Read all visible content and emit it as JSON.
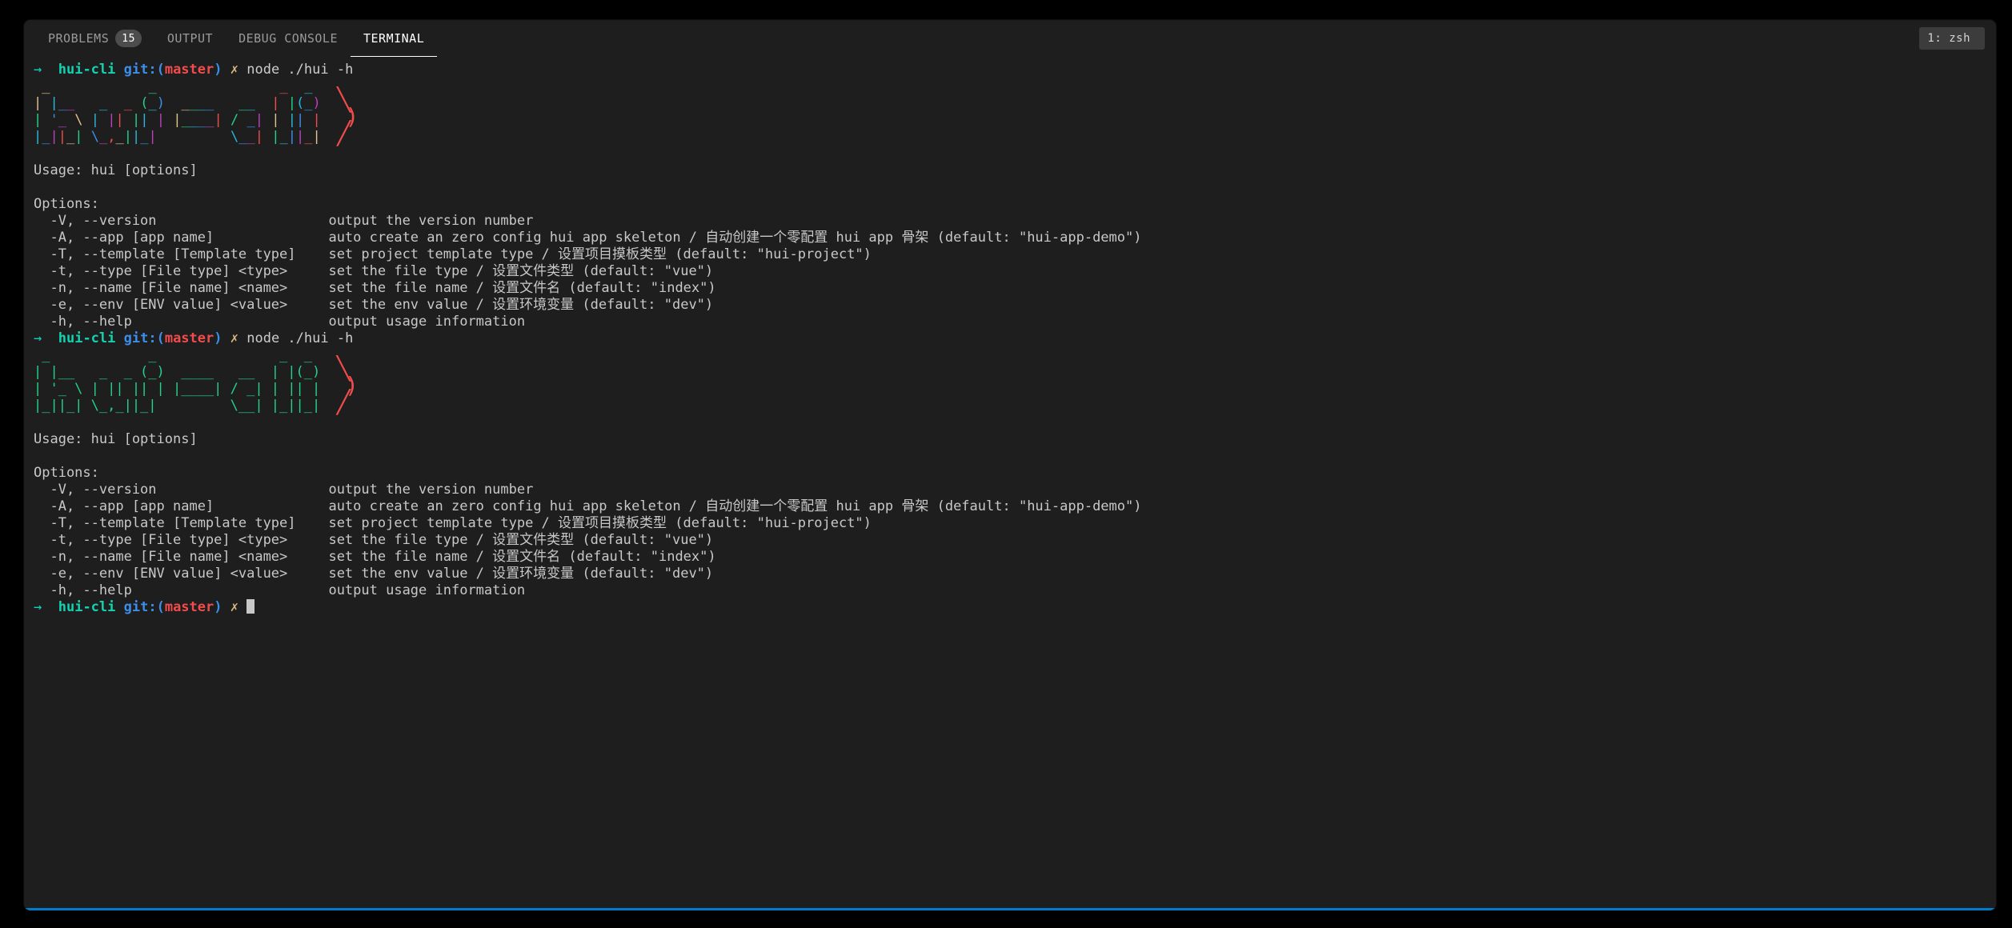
{
  "tabs": {
    "problems": "PROBLEMS",
    "problems_badge": "15",
    "output": "OUTPUT",
    "debug_console": "DEBUG CONSOLE",
    "terminal": "TERMINAL"
  },
  "task_dropdown": "1: zsh",
  "prompt": {
    "arrow": "→",
    "dir": "hui-cli",
    "git_label": "git:(",
    "branch": "master",
    "git_close": ")",
    "dirty": "✗",
    "command": "node ./hui -h"
  },
  "banner_text": "hui-cli",
  "help": {
    "usage_label": "Usage:",
    "usage": "hui [options]",
    "options_label": "Options:",
    "rows": [
      {
        "flag": "-V, --version",
        "desc": "output the version number"
      },
      {
        "flag": "-A, --app [app name]",
        "desc": "auto create an zero config hui app skeleton / 自动创建一个零配置 hui app 骨架 (default: \"hui-app-demo\")"
      },
      {
        "flag": "-T, --template [Template type]",
        "desc": "set project template type / 设置项目摸板类型 (default: \"hui-project\")"
      },
      {
        "flag": "-t, --type [File type] <type>",
        "desc": "set the file type / 设置文件类型 (default: \"vue\")"
      },
      {
        "flag": "-n, --name [File name] <name>",
        "desc": "set the file name / 设置文件名 (default: \"index\")"
      },
      {
        "flag": "-e, --env [ENV value] <value>",
        "desc": "set the env value / 设置环境变量 (default: \"dev\")"
      },
      {
        "flag": "-h, --help",
        "desc": "output usage information"
      }
    ]
  },
  "banner_ascii": [
    " _            _               _  _ ",
    "| |__   _  _ (_)  ____   __  | |(_)",
    "| '_ \\ | || || | |____| / _| | || |",
    "|_||_| \\_,_||_|         \\__| |_||_|"
  ]
}
